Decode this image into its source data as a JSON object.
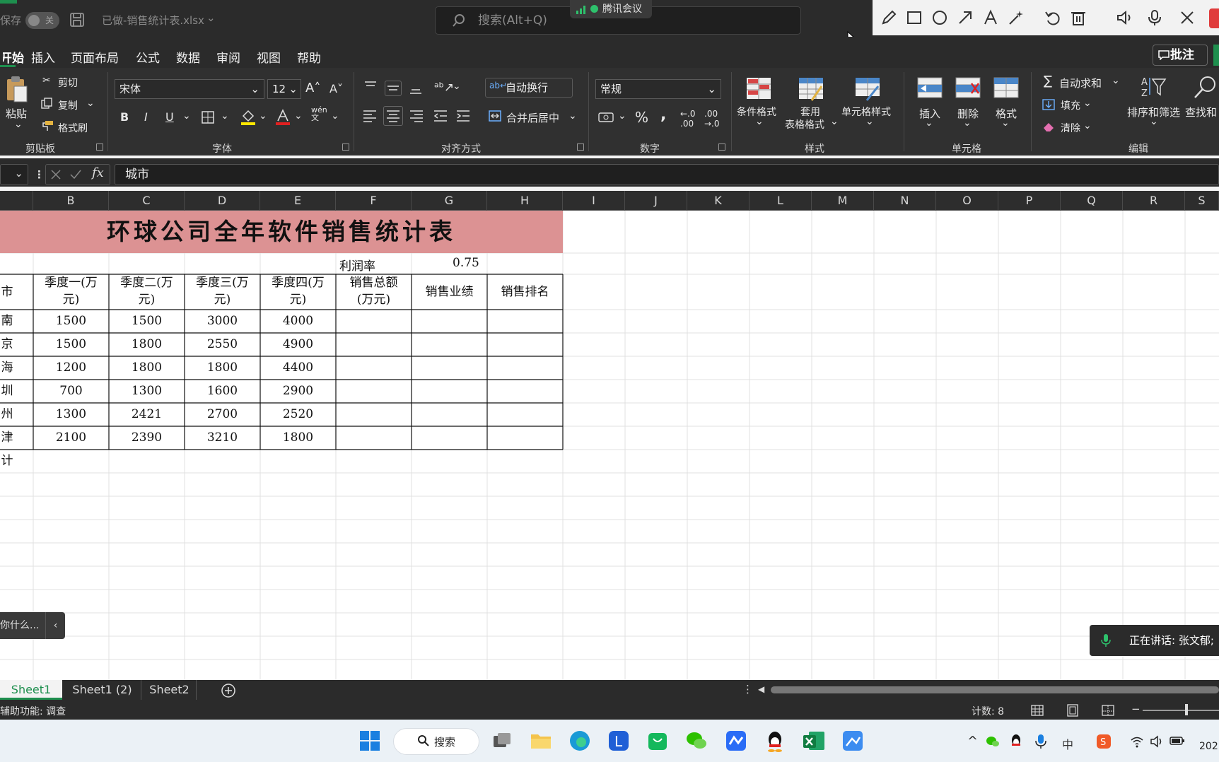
{
  "titlebar": {
    "autosave_label": "保存",
    "autosave_state": "关",
    "filename": "已做-销售统计表.xlsx",
    "search_placeholder": "搜索(Alt+Q)",
    "meeting_label": "腾讯会议"
  },
  "menu": {
    "items": [
      "开始",
      "插入",
      "页面布局",
      "公式",
      "数据",
      "审阅",
      "视图",
      "帮助"
    ],
    "active": "开始",
    "comment_button": "批注"
  },
  "ribbon": {
    "clipboard": {
      "paste": "粘贴",
      "cut": "剪切",
      "copy": "复制",
      "format_painter": "格式刷",
      "label": "剪贴板"
    },
    "font": {
      "name": "宋体",
      "size": "12",
      "label": "字体"
    },
    "alignment": {
      "wrap": "自动换行",
      "merge": "合并后居中",
      "label": "对齐方式"
    },
    "number": {
      "format": "常规",
      "label": "数字"
    },
    "styles": {
      "conditional": "条件格式",
      "table_1": "套用",
      "table_2": "表格格式",
      "cell_styles": "单元格样式",
      "label": "样式"
    },
    "cells": {
      "insert": "插入",
      "delete": "删除",
      "format": "格式",
      "label": "单元格"
    },
    "editing": {
      "autosum": "自动求和",
      "fill": "填充",
      "clear": "清除",
      "sort": "排序和筛选",
      "find": "查找和",
      "label": "编辑"
    }
  },
  "formula_bar": {
    "fx": "fx",
    "value": "城市"
  },
  "columns": [
    "B",
    "C",
    "D",
    "E",
    "F",
    "G",
    "H",
    "I",
    "J",
    "K",
    "L",
    "M",
    "N",
    "O",
    "P",
    "Q",
    "R",
    "S"
  ],
  "sheet": {
    "title": "环球公司全年软件销售统计表",
    "profit_label": "利润率",
    "profit_value": "0.75",
    "headers": [
      {
        "a": "市",
        "b1": "季度一(万",
        "b2": "元)",
        "c1": "季度二(万",
        "c2": "元)",
        "d1": "季度三(万",
        "d2": "元)",
        "e1": "季度四(万",
        "e2": "元)",
        "f1": "销售总额",
        "f2": "(万元)",
        "g": "销售业绩",
        "h": "销售排名"
      }
    ],
    "rows": [
      {
        "city": "南",
        "q1": "1500",
        "q2": "1500",
        "q3": "3000",
        "q4": "4000"
      },
      {
        "city": "京",
        "q1": "1500",
        "q2": "1800",
        "q3": "2550",
        "q4": "4900"
      },
      {
        "city": "海",
        "q1": "1200",
        "q2": "1800",
        "q3": "1800",
        "q4": "4400"
      },
      {
        "city": "圳",
        "q1": "700",
        "q2": "1300",
        "q3": "1600",
        "q4": "2900"
      },
      {
        "city": "州",
        "q1": "1300",
        "q2": "2421",
        "q3": "2700",
        "q4": "2520"
      },
      {
        "city": "津",
        "q1": "2100",
        "q2": "2390",
        "q3": "3210",
        "q4": "1800"
      }
    ],
    "total_label": "计"
  },
  "tabs": [
    "Sheet1",
    "Sheet1 (2)",
    "Sheet2"
  ],
  "active_tab": "Sheet1",
  "tip_text": "你什么...",
  "status": {
    "accessibility": "辅助功能: 调查",
    "count": "计数: 8"
  },
  "speaker": "正在讲话: 张文郁;",
  "taskbar": {
    "search": "搜索",
    "clock": "202"
  },
  "colors": {
    "banner": "#dc9293",
    "accent": "#1e8f4e",
    "ribbon": "#303030"
  }
}
